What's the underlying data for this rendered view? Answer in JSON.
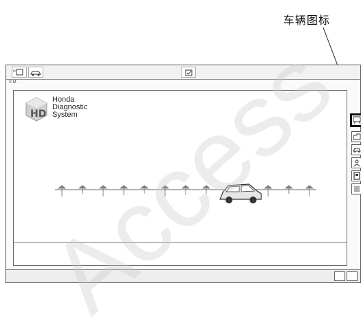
{
  "callout": {
    "label": "车辆图标"
  },
  "toolbar": {
    "left_buttons": [
      {
        "glyph": "▢",
        "icon": "dlc-icon"
      },
      {
        "glyph": "⊂",
        "icon": "car-link-icon"
      }
    ],
    "center_button": {
      "glyph": "☑",
      "icon": "center-tool-icon"
    }
  },
  "logo": {
    "line1": "Honda",
    "line2": "Diagnostic",
    "line3": "System"
  },
  "side_buttons": [
    {
      "icon": "vehicle-icon",
      "glyph": "⛟",
      "active": true
    },
    {
      "icon": "folder-icon",
      "glyph": "⌂",
      "active": false
    },
    {
      "icon": "car-check-icon",
      "glyph": "⊂",
      "active": false
    },
    {
      "icon": "person-icon",
      "glyph": "☺",
      "active": false
    },
    {
      "icon": "meter-icon",
      "glyph": "▣",
      "active": false
    },
    {
      "icon": "list-icon",
      "glyph": "☰",
      "active": false
    }
  ]
}
